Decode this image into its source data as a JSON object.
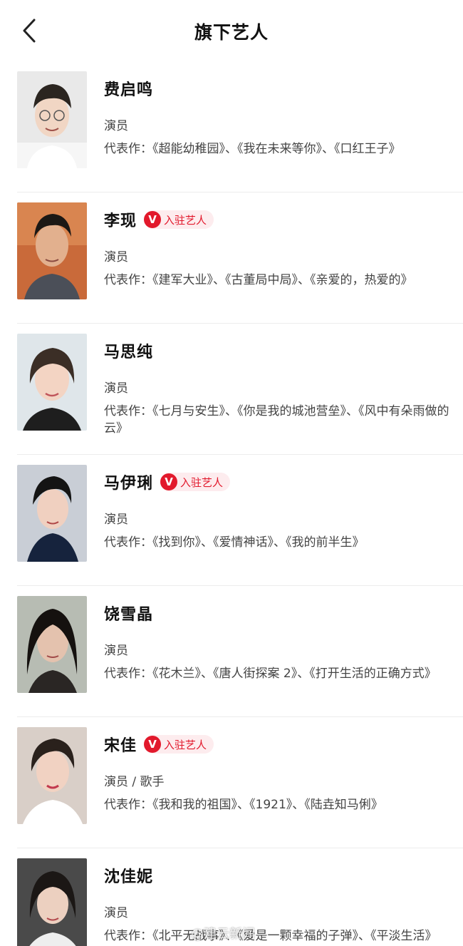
{
  "header": {
    "title": "旗下艺人"
  },
  "badge_label": "入驻艺人",
  "badge_letter": "V",
  "artists": [
    {
      "name": "费启鸣",
      "role": "演员",
      "works": "代表作：《超能幼稚园》、《我在未来等你》、《口红王子》",
      "verified": false
    },
    {
      "name": "李现",
      "role": "演员",
      "works": "代表作：《建军大业》、《古董局中局》、《亲爱的，热爱的》",
      "verified": true
    },
    {
      "name": "马思纯",
      "role": "演员",
      "works": "代表作：《七月与安生》、《你是我的城池营垒》、《风中有朵雨做的云》",
      "verified": false
    },
    {
      "name": "马伊琍",
      "role": "演员",
      "works": "代表作：《找到你》、《爱情神话》、《我的前半生》",
      "verified": true
    },
    {
      "name": "饶雪晶",
      "role": "演员",
      "works": "代表作：《花木兰》、《唐人街探案 2》、《打开生活的正确方式》",
      "verified": false
    },
    {
      "name": "宋佳",
      "role": "演员 / 歌手",
      "works": "代表作：《我和我的祖国》、《1921》、《陆垚知马俐》",
      "verified": true
    },
    {
      "name": "沈佳妮",
      "role": "演员",
      "works": "代表作：《北平无战事》、《爱是一颗幸福的子弹》、《平淡生活》",
      "verified": false
    }
  ],
  "watermark": "@建云新闻",
  "colors": {
    "accent": "#e2192c",
    "badge_bg": "#fdecee"
  }
}
